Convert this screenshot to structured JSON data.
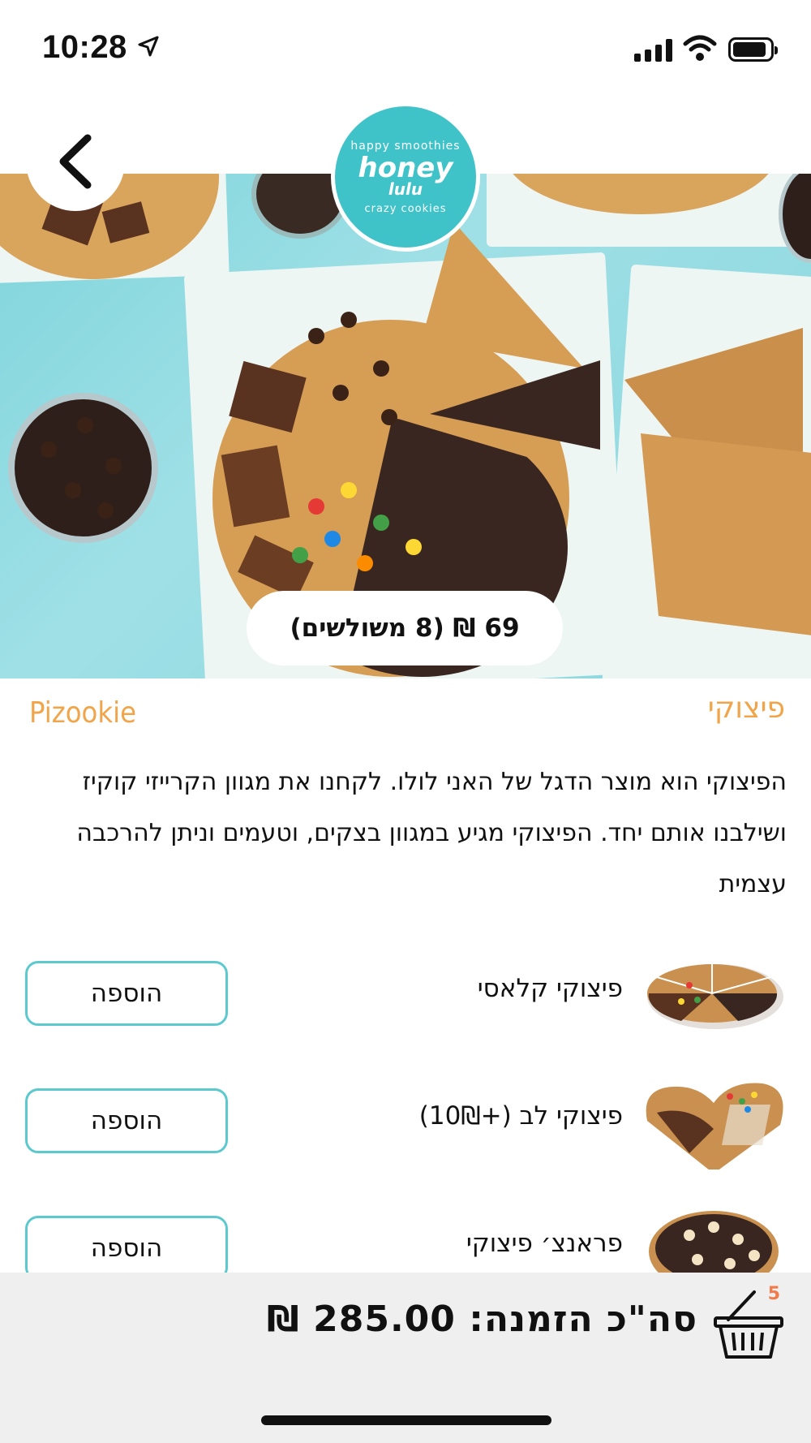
{
  "status_bar": {
    "time": "10:28"
  },
  "header": {
    "back_icon": "chevron-left-icon",
    "logo": {
      "top_text": "happy smoothies",
      "main_text": "honey",
      "sub_text": "lulu",
      "bottom_text": "crazy cookies"
    }
  },
  "hero": {
    "price_label": "69 ₪ (8 משולשים)"
  },
  "title": {
    "hebrew": "פיצוקי",
    "english": "Pizookie"
  },
  "description": "הפיצוקי הוא מוצר הדגל של האני לולו. לקחנו את מגוון הקרייזי קוקיז ושילבנו אותם יחד. הפיצוקי מגיע במגוון בצקים, וטעמים וניתן להרכבה עצמית",
  "products": [
    {
      "name": "פיצוקי קלאסי",
      "add_label": "הוספה"
    },
    {
      "name": "פיצוקי לב (+10₪)",
      "add_label": "הוספה"
    },
    {
      "name": "פראנצ׳ פיצוקי",
      "add_label": "הוספה"
    }
  ],
  "bottom_bar": {
    "cart_count": "5",
    "total_label": "סה\"כ הזמנה: 285.00 ₪"
  },
  "colors": {
    "accent_orange": "#f0a54a",
    "button_border": "#5cc9cf",
    "brand_teal": "#3fc3c9",
    "badge": "#f07a4a"
  }
}
